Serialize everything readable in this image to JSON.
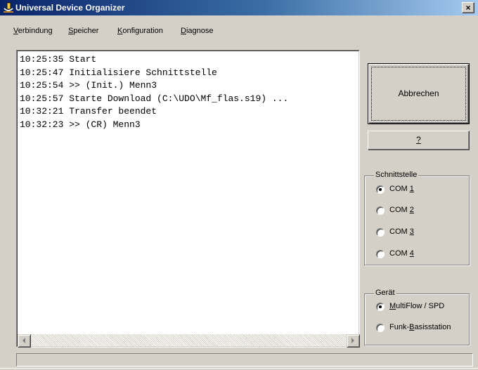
{
  "window": {
    "title": "Universal Device Organizer",
    "close_symbol": "×",
    "icon": "udo-app-icon"
  },
  "menu": [
    {
      "key": "V",
      "rest": "erbindung"
    },
    {
      "key": "S",
      "rest": "peicher"
    },
    {
      "key": "K",
      "rest": "onfiguration"
    },
    {
      "key": "D",
      "rest": "iagnose"
    }
  ],
  "log": {
    "lines": [
      "10:25:35 Start",
      "10:25:47 Initialisiere Schnittstelle",
      "10:25:54 >> (Init.) Menn3",
      "10:25:57 Starte Download (C:\\UDO\\Mf_flas.s19) ...",
      "10:32:21 Transfer beendet",
      "10:32:23 >> (CR) Menn3"
    ]
  },
  "scrollbar": {
    "left_icon": "arrow-left-icon",
    "right_icon": "arrow-right-icon"
  },
  "buttons": {
    "abort_label": "Abbrechen",
    "help_label": "?"
  },
  "interface_group": {
    "title": "Schnittstelle",
    "options": [
      {
        "prefix": "COM ",
        "key": "1",
        "rest": "",
        "selected": true
      },
      {
        "prefix": "COM ",
        "key": "2",
        "rest": "",
        "selected": false
      },
      {
        "prefix": "COM ",
        "key": "3",
        "rest": "",
        "selected": false
      },
      {
        "prefix": "COM ",
        "key": "4",
        "rest": "",
        "selected": false
      }
    ]
  },
  "device_group": {
    "title": "Gerät",
    "options": [
      {
        "prefix": "",
        "key": "M",
        "rest": "ultiFlow / SPD",
        "selected": true
      },
      {
        "prefix": "Funk-",
        "key": "B",
        "rest": "asisstation",
        "selected": false
      }
    ]
  },
  "statusbar": {
    "text": ""
  }
}
